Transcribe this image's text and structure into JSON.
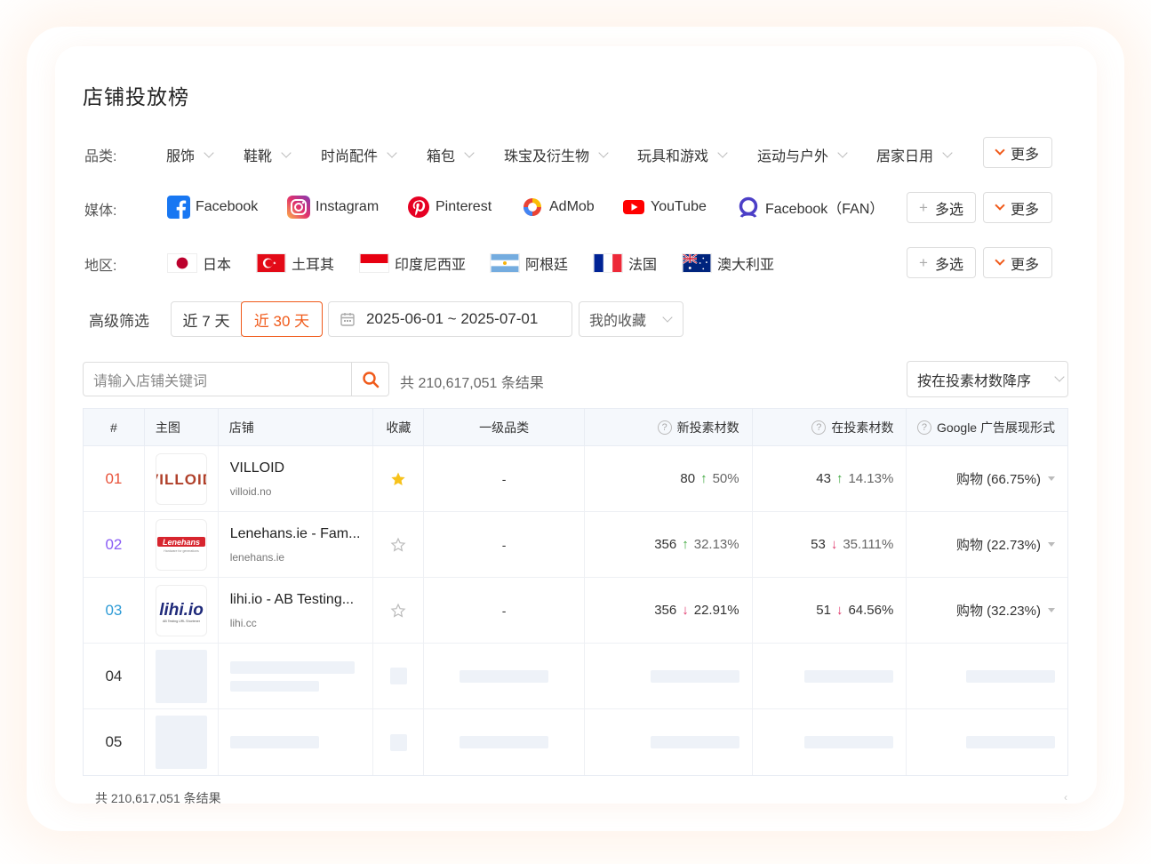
{
  "page": {
    "title": "店铺投放榜"
  },
  "filters": {
    "category_label": "品类:",
    "categories": [
      "服饰",
      "鞋靴",
      "时尚配件",
      "箱包",
      "珠宝及衍生物",
      "玩具和游戏",
      "运动与户外",
      "居家日用"
    ],
    "more_label": "更多",
    "multi_label": "多选",
    "media_label": "媒体:",
    "media": [
      {
        "label": "Facebook",
        "icon": "facebook-icon"
      },
      {
        "label": "Instagram",
        "icon": "instagram-icon"
      },
      {
        "label": "Pinterest",
        "icon": "pinterest-icon"
      },
      {
        "label": "AdMob",
        "icon": "admob-icon"
      },
      {
        "label": "YouTube",
        "icon": "youtube-icon"
      },
      {
        "label": "Facebook（FAN）",
        "icon": "facebook-audience-network-icon"
      }
    ],
    "region_label": "地区:",
    "regions": [
      "日本",
      "土耳其",
      "印度尼西亚",
      "阿根廷",
      "法国",
      "澳大利亚"
    ]
  },
  "advanced": {
    "label": "高级筛选",
    "range_7": "近 7 天",
    "range_30": "近 30 天",
    "active_range": "近 30 天",
    "date_range": "2025-06-01 ~ 2025-07-01",
    "favorites": "我的收藏"
  },
  "search": {
    "placeholder": "请输入店铺关键词",
    "result_count": "共 210,617,051 条结果",
    "sort": "按在投素材数降序"
  },
  "table": {
    "headers": {
      "rank": "#",
      "image": "主图",
      "store": "店铺",
      "favorite": "收藏",
      "category": "一级品类",
      "new_ads": "新投素材数",
      "active_ads": "在投素材数",
      "format": "Google 广告展现形式"
    },
    "rows": [
      {
        "rank": "01",
        "rank_color": "#e8523a",
        "name": "VILLOID",
        "domain": "villoid.no",
        "favorited": true,
        "category": "-",
        "new_ads": "80",
        "new_dir": "up",
        "new_pct": "50%",
        "active_ads": "43",
        "active_dir": "up",
        "active_pct": "14.13%",
        "format": "购物 (66.75%)"
      },
      {
        "rank": "02",
        "rank_color": "#8a5cf5",
        "name": "Lenehans.ie - Fam...",
        "domain": "lenehans.ie",
        "favorited": false,
        "category": "-",
        "new_ads": "356",
        "new_dir": "up",
        "new_pct": "32.13%",
        "active_ads": "53",
        "active_dir": "down",
        "active_pct": "35.111%",
        "format": "购物 (22.73%)"
      },
      {
        "rank": "03",
        "rank_color": "#2e9bd6",
        "name": "lihi.io - AB Testing...",
        "domain": "lihi.cc",
        "favorited": false,
        "category": "-",
        "new_ads": "356",
        "new_dir": "down",
        "new_pct": "22.91%",
        "active_ads": "51",
        "active_dir": "down",
        "active_pct": "64.56%",
        "format": "购物 (32.23%)"
      },
      {
        "rank": "04",
        "rank_color": "#333333"
      },
      {
        "rank": "05",
        "rank_color": "#333333"
      }
    ],
    "logos": {
      "villoid": "VILLOID",
      "lenehans": "Lenehans",
      "lenehans_tag": "Hardware for generations",
      "lihi": "lihi.io",
      "lihi_tag": "AB Testing URL Shortener"
    }
  },
  "footer": {
    "result_count": "共 210,617,051 条结果"
  },
  "colors": {
    "accent": "#f05a1a",
    "up": "#3aa63a",
    "down": "#e0366b"
  }
}
